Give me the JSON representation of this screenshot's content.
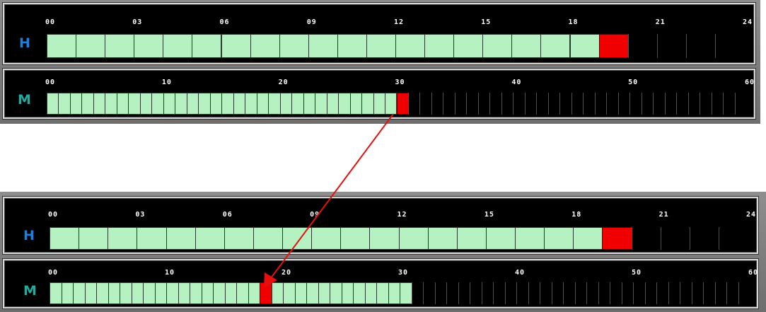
{
  "colors": {
    "hours_letter": "#1e7fd8",
    "minutes_letter": "#18b0a0",
    "filled": "#b6f2c1",
    "current": "#f00000",
    "arrow": "#e41010"
  },
  "clocks": [
    {
      "id": "before",
      "hours": {
        "letter": "H",
        "tick_labels": [
          "00",
          "03",
          "06",
          "09",
          "12",
          "15",
          "18",
          "21",
          "24"
        ],
        "total_segments": 24,
        "filled_segments": 19,
        "current_segment_index": 19
      },
      "minutes": {
        "letter": "M",
        "tick_labels": [
          "00",
          "10",
          "20",
          "30",
          "40",
          "50",
          "60"
        ],
        "total_segments": 60,
        "filled_segments": 30,
        "current_segment_index": 30
      }
    },
    {
      "id": "after",
      "hours": {
        "letter": "H",
        "tick_labels": [
          "00",
          "03",
          "06",
          "09",
          "12",
          "15",
          "18",
          "21",
          "24"
        ],
        "total_segments": 24,
        "filled_segments": 19,
        "current_segment_index": 19
      },
      "minutes": {
        "letter": "M",
        "tick_labels": [
          "00",
          "10",
          "20",
          "30",
          "40",
          "50",
          "60"
        ],
        "total_segments": 60,
        "filled_segments": 31,
        "current_segment_index": 18
      }
    }
  ]
}
